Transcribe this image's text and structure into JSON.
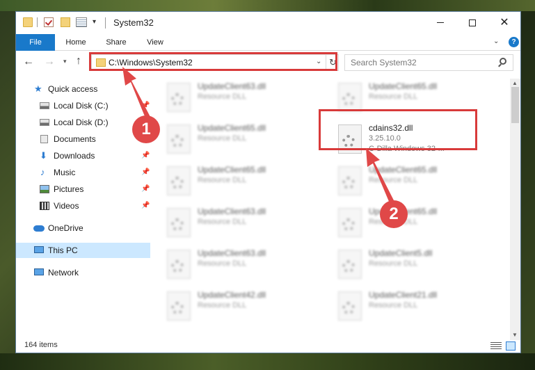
{
  "window": {
    "title": "System32",
    "controls": {
      "minimize": "–",
      "maximize": "☐",
      "close": "✕"
    }
  },
  "quick_access_toolbar": {
    "dropdown_glyph": "▾"
  },
  "ribbon": {
    "tabs": [
      "File",
      "Home",
      "Share",
      "View"
    ],
    "expand_glyph": "⌄",
    "help_glyph": "?"
  },
  "navigation": {
    "back_glyph": "←",
    "forward_glyph": "→",
    "recent_glyph": "▾",
    "up_glyph": "↑",
    "address": "C:\\Windows\\System32",
    "address_dropdown_glyph": "⌄",
    "refresh_glyph": "↻",
    "search_placeholder": "Search System32"
  },
  "sidebar": {
    "items": [
      {
        "label": "Quick access",
        "icon": "star-icon",
        "pinned": false
      },
      {
        "label": "Local Disk (C:)",
        "icon": "disk-icon",
        "pinned": true
      },
      {
        "label": "Local Disk (D:)",
        "icon": "disk-icon",
        "pinned": false
      },
      {
        "label": "Documents",
        "icon": "documents-icon",
        "pinned": true
      },
      {
        "label": "Downloads",
        "icon": "download-icon",
        "pinned": true
      },
      {
        "label": "Music",
        "icon": "music-icon",
        "pinned": true
      },
      {
        "label": "Pictures",
        "icon": "pictures-icon",
        "pinned": true
      },
      {
        "label": "Videos",
        "icon": "videos-icon",
        "pinned": true
      },
      {
        "label": "OneDrive",
        "icon": "onedrive-icon",
        "pinned": false
      },
      {
        "label": "This PC",
        "icon": "computer-icon",
        "pinned": false,
        "selected": true
      },
      {
        "label": "Network",
        "icon": "network-icon",
        "pinned": false
      }
    ],
    "pin_glyph": "📌"
  },
  "files": {
    "left_column": [
      {
        "name": "UpdateClient63.dll",
        "desc": "Resource DLL"
      },
      {
        "name": "UpdateClient65.dll",
        "desc": "Resource DLL"
      },
      {
        "name": "UpdateClient65.dll",
        "desc": "Resource DLL"
      },
      {
        "name": "UpdateClient63.dll",
        "desc": "Resource DLL"
      },
      {
        "name": "UpdateClient63.dll",
        "desc": "Resource DLL"
      },
      {
        "name": "UpdateClient42.dll",
        "desc": "Resource DLL"
      }
    ],
    "right_column": [
      {
        "name": "UpdateClient65.dll",
        "desc": "Resource DLL"
      },
      {
        "name": "UpdateClient65.dll",
        "desc": "Resource DLL"
      },
      {
        "name": "UpdateClient65.dll",
        "desc": "Resource DLL"
      },
      {
        "name": "UpdateClient5.dll",
        "desc": "Resource DLL"
      },
      {
        "name": "UpdateClient21.dll",
        "desc": "Resource DLL"
      }
    ],
    "highlighted": {
      "name": "cdains32.dll",
      "version": "3.25.10.0",
      "desc": "C-Dilla Windows 32-..."
    }
  },
  "status": {
    "item_count": "164 items"
  },
  "annotations": {
    "callout_1": "1",
    "callout_2": "2",
    "highlight_color": "#d83a3a",
    "callout_color": "#e04848"
  },
  "colors": {
    "accent": "#1979ca",
    "selection": "#cce8ff"
  }
}
